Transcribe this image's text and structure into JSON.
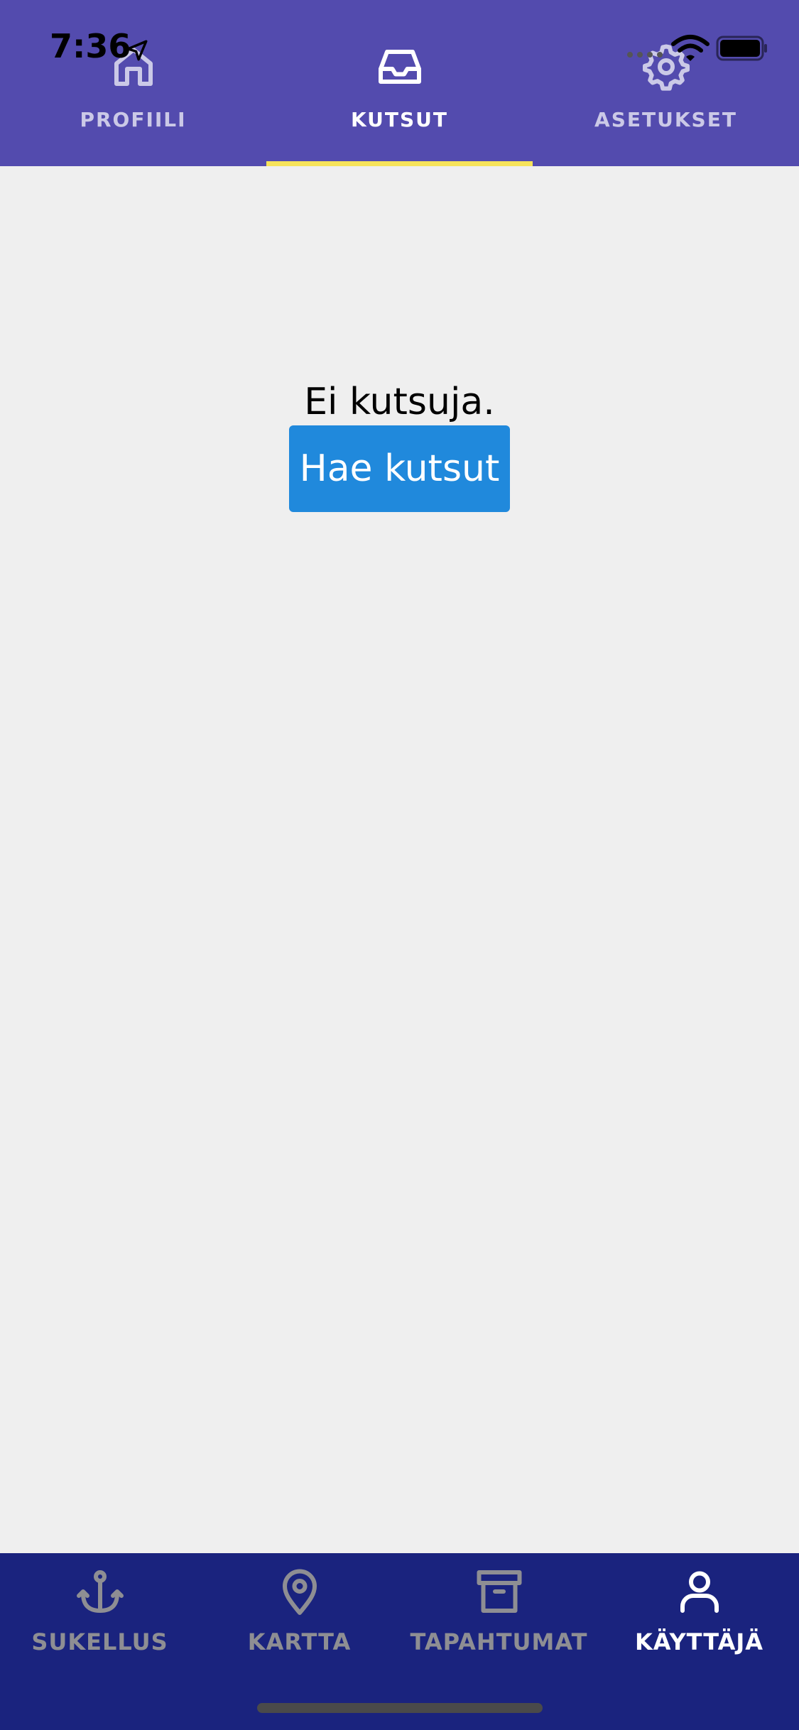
{
  "status_bar": {
    "time": "7:36"
  },
  "top_tabs": [
    {
      "label": "PROFIILI",
      "icon": "home-icon",
      "active": false
    },
    {
      "label": "KUTSUT",
      "icon": "inbox-icon",
      "active": true
    },
    {
      "label": "ASETUKSET",
      "icon": "gear-icon",
      "active": false
    }
  ],
  "main": {
    "empty_message": "Ei kutsuja.",
    "fetch_button_label": "Hae kutsut"
  },
  "bottom_tabs": [
    {
      "label": "SUKELLUS",
      "icon": "anchor-icon",
      "active": false
    },
    {
      "label": "KARTTA",
      "icon": "map-pin-icon",
      "active": false
    },
    {
      "label": "TAPAHTUMAT",
      "icon": "archive-icon",
      "active": false
    },
    {
      "label": "KÄYTTÄJÄ",
      "icon": "user-icon",
      "active": true
    }
  ],
  "colors": {
    "header_bg": "#534bae",
    "tab_indicator": "#f6e35a",
    "button_bg": "#2089dc",
    "bottom_bar_bg": "#1a237e",
    "content_bg": "#efefef",
    "inactive_bottom_label": "#8e8e93"
  }
}
